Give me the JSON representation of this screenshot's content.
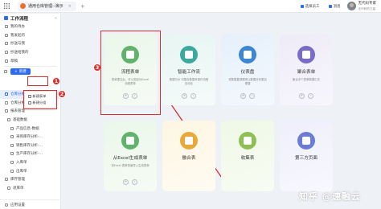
{
  "topbar": {
    "tab_label": "通用仓库管理--演示",
    "tab_close": "×",
    "new_tab": "+",
    "btn_select": "选择员工",
    "btn_chat": "消息",
    "user_name": "无代码专家",
    "user_sub": "无代码的力量"
  },
  "sidebar": {
    "title": "工作流程",
    "collapse": "«",
    "items_top": [
      {
        "label": "我的待办"
      },
      {
        "label": "我发起的"
      },
      {
        "label": "抄送与我"
      },
      {
        "label": "抄送给我的"
      },
      {
        "label": "草稿"
      }
    ],
    "new_button": "新建",
    "items_group": [
      {
        "label": "仓库分析"
      },
      {
        "label": "仓库分析"
      },
      {
        "label": "报表管理"
      },
      {
        "label": "基础数据"
      },
      {
        "label": "产品信息-数据"
      },
      {
        "label": "采购库存分析-..."
      },
      {
        "label": "销售库存分析-..."
      },
      {
        "label": "生产库存分析-..."
      },
      {
        "label": "入库单"
      },
      {
        "label": "出库单"
      },
      {
        "label": "库存管理"
      },
      {
        "label": "退库单"
      }
    ],
    "app_settings": "应用设置"
  },
  "dropdown": {
    "items": [
      {
        "label": "新建表单"
      },
      {
        "label": "新建分组"
      }
    ]
  },
  "annotations": {
    "one": "1",
    "two": "2",
    "three": "3",
    "color": "#d9302c"
  },
  "cards": [
    {
      "title": "流程表单",
      "desc": "表单提交后，可以发起为Excel 流程表单",
      "color": "#5fb36a"
    },
    {
      "title": "智能工作流",
      "desc": "数据与AI 可整合数据来操作流程自动化",
      "color": "#3aa99f"
    },
    {
      "title": "仪表盘",
      "desc": "将数据直观展现让数据分析更加便捷",
      "color": "#3d86d6"
    },
    {
      "title": "聚合表单",
      "desc": "聚合多个表单数据汇总",
      "color": "#7b6bc9"
    },
    {
      "title": "从Excel生成表单",
      "desc": "将Excel 表单快速导入生成表单",
      "color": "#5fb36a"
    },
    {
      "title": "融合表",
      "desc": "",
      "color": "#e9a93a"
    },
    {
      "title": "收集表",
      "desc": "",
      "color": "#8cc152"
    },
    {
      "title": "第三方页面",
      "desc": "",
      "color": "#6b7bd6"
    }
  ],
  "watermark": "知乎 @速融云"
}
